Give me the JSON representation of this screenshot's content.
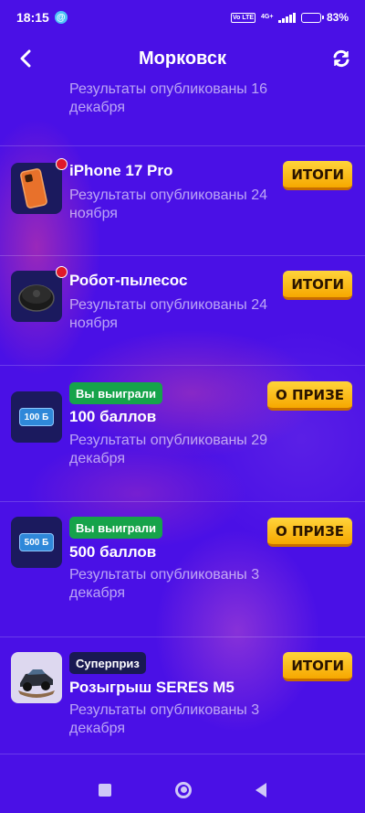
{
  "status_bar": {
    "time": "18:15",
    "at_symbol": "@",
    "volte_badge": "Vo LTE",
    "network": "4G+",
    "battery_percent": "83",
    "battery_level": 0.83
  },
  "header": {
    "title": "Морковск",
    "back_icon": "chevron-left-icon",
    "refresh_icon": "refresh-icon"
  },
  "items": [
    {
      "name": "",
      "description": "Результаты опубликованы 16 декабря"
    },
    {
      "name": "iPhone 17 Pro",
      "description": "Результаты опубликованы 24 ноября",
      "action": "ИТОГИ",
      "new_dot": true,
      "thumb_icon": "iphone-icon"
    },
    {
      "name": "Робот-пылесос",
      "description": "Результаты опубликованы 24 ноября",
      "action": "ИТОГИ",
      "new_dot": true,
      "thumb_icon": "robot-vacuum-icon"
    },
    {
      "badge": "Вы выиграли",
      "name": "100 баллов",
      "description": "Результаты опубликованы 29 декабря",
      "action": "О ПРИЗЕ",
      "thumb_label": "100 Б",
      "thumb_icon": "points-card-icon"
    },
    {
      "badge": "Вы выиграли",
      "name": "500 баллов",
      "description": "Результаты опубликованы 3 декабря",
      "action": "О ПРИЗЕ",
      "thumb_label": "500 Б",
      "thumb_icon": "points-card-icon"
    },
    {
      "badge": "Суперприз",
      "name": "Розыгрыш SERES M5",
      "description": "Результаты опубликованы 3 декабря",
      "action": "ИТОГИ",
      "thumb_icon": "car-icon"
    }
  ],
  "colors": {
    "background": "#4a10e6",
    "win_badge": "#16a34a",
    "super_badge": "#191952",
    "action_button": "#ffc21a",
    "notification_dot": "#e0182a"
  }
}
